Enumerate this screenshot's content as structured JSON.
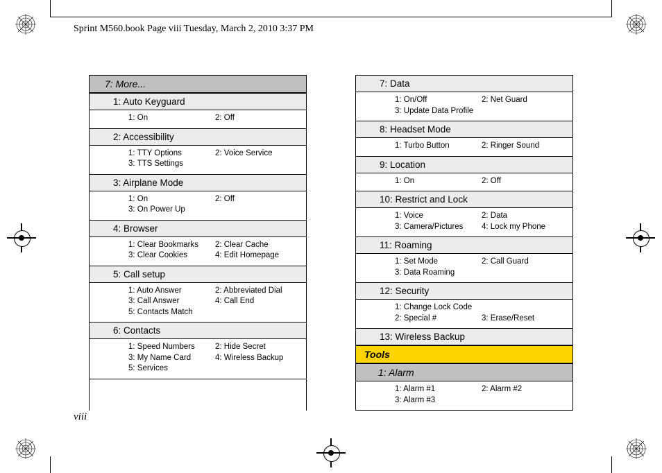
{
  "header": "Sprint M560.book  Page viii  Tuesday, March 2, 2010  3:37 PM",
  "page_number": "viii",
  "left_column": {
    "top_heading": "7: More...",
    "sections": [
      {
        "title": "1: Auto Keyguard",
        "opts": [
          "1: On",
          "2: Off"
        ]
      },
      {
        "title": "2: Accessibility",
        "opts": [
          "1: TTY Options",
          "2: Voice Service",
          "3: TTS Settings"
        ]
      },
      {
        "title": "3: Airplane Mode",
        "opts": [
          "1: On",
          "2: Off",
          "3: On Power Up"
        ]
      },
      {
        "title": "4: Browser",
        "opts": [
          "1: Clear Bookmarks",
          "2: Clear Cache",
          "3: Clear Cookies",
          "4: Edit Homepage"
        ]
      },
      {
        "title": "5: Call setup",
        "opts": [
          "1: Auto Answer",
          "2: Abbreviated Dial",
          "3: Call Answer",
          "4: Call End",
          "5: Contacts Match"
        ]
      },
      {
        "title": "6: Contacts",
        "opts": [
          "1: Speed Numbers",
          "2: Hide Secret",
          "3: My Name Card",
          "4: Wireless Backup",
          "5: Services"
        ]
      }
    ]
  },
  "right_column": {
    "sections_a": [
      {
        "title": "7: Data",
        "opts": [
          "1: On/Off",
          "2: Net Guard",
          "3: Update Data Profile"
        ]
      },
      {
        "title": "8: Headset Mode",
        "opts": [
          "1: Turbo Button",
          "2: Ringer Sound"
        ]
      },
      {
        "title": "9: Location",
        "opts": [
          "1: On",
          "2: Off"
        ]
      },
      {
        "title": "10: Restrict and Lock",
        "opts": [
          "1: Voice",
          "2: Data",
          "3: Camera/Pictures",
          "4: Lock my Phone"
        ]
      },
      {
        "title": "11: Roaming",
        "opts": [
          "1: Set Mode",
          "2: Call Guard",
          "3: Data Roaming"
        ]
      },
      {
        "title": "12: Security",
        "opts": [
          "1: Change Lock Code",
          "",
          "2: Special #",
          "3: Erase/Reset"
        ]
      },
      {
        "title": "13: Wireless Backup",
        "opts": []
      }
    ],
    "tools_heading": "Tools",
    "alarm_heading": "1: Alarm",
    "alarm_opts": [
      "1: Alarm #1",
      "2: Alarm #2",
      "3: Alarm #3"
    ]
  }
}
